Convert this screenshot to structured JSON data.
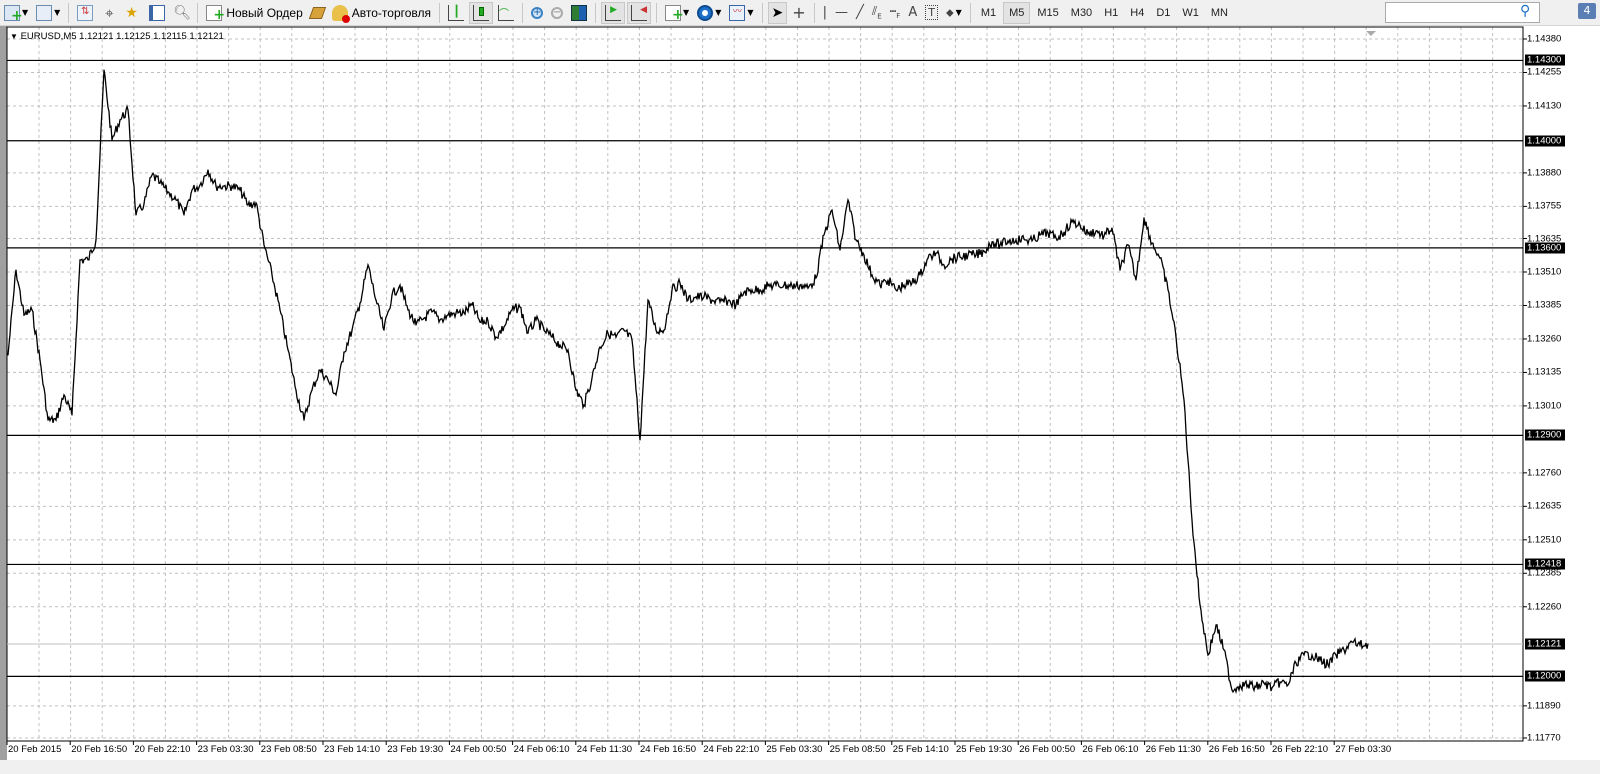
{
  "toolbar": {
    "new_order_label": "Новый Ордер",
    "autotrading_label": "Авто-торговля",
    "timeframes": [
      "M1",
      "M5",
      "M15",
      "M30",
      "H1",
      "H4",
      "D1",
      "W1",
      "MN"
    ],
    "active_timeframe": "M5",
    "search_placeholder": "",
    "notification_count": "4"
  },
  "chart": {
    "legend": "EURUSD,M5  1.12121 1.12125 1.12115 1.12121",
    "colors": {
      "line": "#000000",
      "grid": "#c0c0c0",
      "label_bg": "#000000",
      "label_fg": "#ffffff"
    },
    "y_ticks": [
      "1.14380",
      "1.14255",
      "1.14130",
      "1.13880",
      "1.13755",
      "1.13635",
      "1.13510",
      "1.13385",
      "1.13260",
      "1.13135",
      "1.13010",
      "1.12760",
      "1.12635",
      "1.12510",
      "1.12385",
      "1.12260",
      "1.11890",
      "1.11770"
    ],
    "horizontal_lines": [
      "1.14300",
      "1.14000",
      "1.13600",
      "1.12900",
      "1.12418",
      "1.12000"
    ],
    "current_price": "1.12121",
    "x_ticks": [
      "20 Feb 2015",
      "20 Feb 16:50",
      "20 Feb 22:10",
      "23 Feb 03:30",
      "23 Feb 08:50",
      "23 Feb 14:10",
      "23 Feb 19:30",
      "24 Feb 00:50",
      "24 Feb 06:10",
      "24 Feb 11:30",
      "24 Feb 16:50",
      "24 Feb 22:10",
      "25 Feb 03:30",
      "25 Feb 08:50",
      "25 Feb 14:10",
      "25 Feb 19:30",
      "26 Feb 00:50",
      "26 Feb 06:10",
      "26 Feb 11:30",
      "26 Feb 16:50",
      "26 Feb 22:10",
      "27 Feb 03:30"
    ]
  },
  "chart_data": {
    "type": "line",
    "symbol": "EURUSD",
    "timeframe": "M5",
    "ylim": [
      1.1177,
      1.1438
    ],
    "grid": true,
    "start": "20 Feb 2015 11:30",
    "interval_minutes": 40,
    "close": [
      1.132,
      1.13517,
      1.13349,
      1.13368,
      1.13181,
      1.12957,
      1.12957,
      1.13051,
      1.12976,
      1.13555,
      1.13555,
      1.1363,
      1.14264,
      1.14003,
      1.14078,
      1.14115,
      1.13723,
      1.13764,
      1.13872,
      1.13842,
      1.13809,
      1.13779,
      1.13723,
      1.13816,
      1.13835,
      1.13891,
      1.13831,
      1.13831,
      1.13831,
      1.13816,
      1.1376,
      1.13768,
      1.13611,
      1.13499,
      1.13368,
      1.13219,
      1.13069,
      1.12957,
      1.13069,
      1.13144,
      1.13107,
      1.13051,
      1.13211,
      1.13293,
      1.13394,
      1.13536,
      1.13405,
      1.13293,
      1.13424,
      1.13461,
      1.13368,
      1.13312,
      1.13338,
      1.13361,
      1.13331,
      1.13349,
      1.13357,
      1.13357,
      1.13387,
      1.13323,
      1.13327,
      1.13267,
      1.13305,
      1.13368,
      1.13379,
      1.13282,
      1.13331,
      1.13293,
      1.13267,
      1.13237,
      1.13219,
      1.13069,
      1.13013,
      1.13114,
      1.1323,
      1.13282,
      1.13267,
      1.13293,
      1.13256,
      1.12883,
      1.13405,
      1.13293,
      1.13293,
      1.13443,
      1.13469,
      1.13405,
      1.13417,
      1.13417,
      1.13405,
      1.13398,
      1.13402,
      1.13387,
      1.13435,
      1.13443,
      1.13443,
      1.13458,
      1.13461,
      1.13461,
      1.13458,
      1.13461,
      1.1345,
      1.13488,
      1.13648,
      1.13741,
      1.13592,
      1.13779,
      1.1363,
      1.13573,
      1.13499,
      1.13461,
      1.1348,
      1.13443,
      1.13461,
      1.13469,
      1.13499,
      1.13562,
      1.13581,
      1.13536,
      1.13559,
      1.13566,
      1.13573,
      1.13573,
      1.13588,
      1.13622,
      1.13611,
      1.13626,
      1.1363,
      1.13633,
      1.13626,
      1.13648,
      1.13656,
      1.13637,
      1.13659,
      1.13697,
      1.13685,
      1.13652,
      1.13663,
      1.13644,
      1.13674,
      1.13517,
      1.13611,
      1.1348,
      1.13712,
      1.13618,
      1.13562,
      1.13443,
      1.13267,
      1.13032,
      1.12584,
      1.12267,
      1.1208,
      1.12192,
      1.12099,
      1.11949,
      1.11968,
      1.11968,
      1.1196,
      1.11975,
      1.11957,
      1.11979,
      1.11968,
      1.1205,
      1.1208,
      1.1208,
      1.12061,
      1.12043,
      1.1208,
      1.12099,
      1.12128,
      1.12117,
      1.12121
    ]
  }
}
